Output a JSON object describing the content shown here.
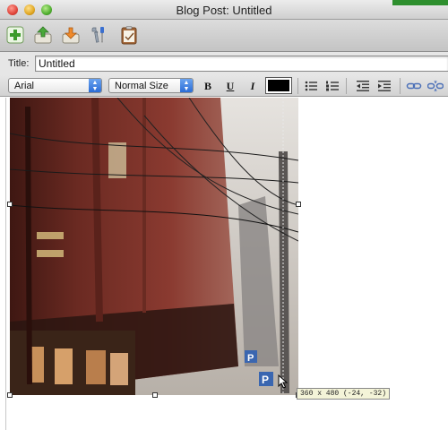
{
  "window": {
    "title": "Blog Post: Untitled"
  },
  "toolbar": {
    "buttons": [
      {
        "icon": "add-icon"
      },
      {
        "icon": "upload-icon"
      },
      {
        "icon": "download-icon"
      },
      {
        "icon": "tools-icon"
      },
      {
        "icon": "clipboard-icon"
      }
    ]
  },
  "post": {
    "title_label": "Title:",
    "title_value": "Untitled"
  },
  "format": {
    "font": "Arial",
    "size": "Normal Size",
    "bold": "B",
    "underline": "U",
    "italic": "I",
    "text_color": "#000000",
    "icons": [
      "bulleted-list-icon",
      "numbered-list-icon",
      "outdent-icon",
      "indent-icon",
      "link-icon",
      "unlink-icon"
    ]
  },
  "image": {
    "size_tip": "360 x 480 (-24, -32)"
  },
  "colors": {
    "accent": "#2b6cd6"
  }
}
